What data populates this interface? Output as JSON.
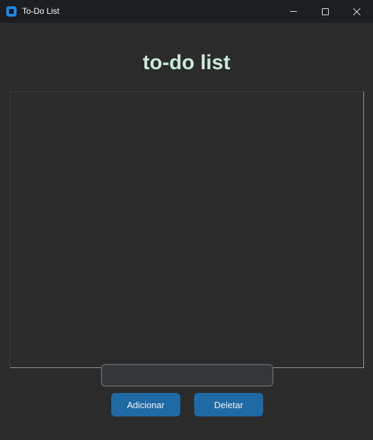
{
  "window": {
    "title": "To-Do List",
    "controls": {
      "minimize_icon": "minimize-icon",
      "maximize_icon": "maximize-icon",
      "close_icon": "close-icon"
    }
  },
  "main": {
    "heading": "to-do list",
    "task_list": {
      "items": []
    },
    "task_input": {
      "value": "",
      "placeholder": ""
    },
    "buttons": {
      "add_label": "Adicionar",
      "delete_label": "Deletar"
    }
  },
  "colors": {
    "background": "#2b2b2b",
    "titlebar": "#1c1e22",
    "heading": "#c9ebd6",
    "button": "#1f6aa5",
    "input_bg": "#343638",
    "input_border": "#565b5e"
  }
}
